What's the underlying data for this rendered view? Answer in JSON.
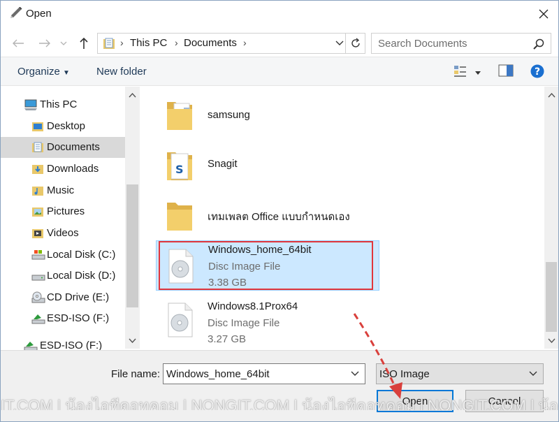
{
  "window": {
    "title": "Open",
    "title_icon": "pen-icon",
    "close_icon": "close-icon"
  },
  "navigation": {
    "back_icon": "back-arrow-icon",
    "forward_icon": "forward-arrow-icon",
    "recent_icon": "chevron-down-icon",
    "up_icon": "up-arrow-icon",
    "breadcrumb": [
      "This PC",
      "Documents"
    ],
    "search_placeholder": "Search Documents"
  },
  "toolbar": {
    "organize_label": "Organize",
    "new_folder_label": "New folder"
  },
  "sidebar": {
    "items": [
      {
        "label": "This PC",
        "icon": "computer-icon"
      },
      {
        "label": "Desktop",
        "icon": "desktop-folder-icon"
      },
      {
        "label": "Documents",
        "icon": "documents-folder-icon",
        "selected": true
      },
      {
        "label": "Downloads",
        "icon": "downloads-folder-icon"
      },
      {
        "label": "Music",
        "icon": "music-folder-icon"
      },
      {
        "label": "Pictures",
        "icon": "pictures-folder-icon"
      },
      {
        "label": "Videos",
        "icon": "videos-folder-icon"
      },
      {
        "label": "Local Disk (C:)",
        "icon": "local-disk-icon"
      },
      {
        "label": "Local Disk (D:)",
        "icon": "local-disk-icon"
      },
      {
        "label": "CD Drive (E:)",
        "icon": "cd-drive-icon"
      },
      {
        "label": "ESD-ISO (F:)",
        "icon": "usb-drive-icon"
      },
      {
        "label": "ESD-ISO (F:)",
        "icon": "usb-drive-icon"
      }
    ]
  },
  "files": [
    {
      "name": "samsung",
      "kind": "folder",
      "icon": "folder-icon"
    },
    {
      "name": "Snagit",
      "kind": "folder",
      "icon": "folder-icon"
    },
    {
      "name": "เทมเพลต Office แบบกำหนดเอง",
      "kind": "folder",
      "icon": "folder-icon"
    },
    {
      "name": "Windows_home_64bit",
      "type": "Disc Image File",
      "size": "3.38 GB",
      "icon": "disc-image-icon",
      "selected": true
    },
    {
      "name": "Windows8.1Prox64",
      "type": "Disc Image File",
      "size": "3.27 GB",
      "icon": "disc-image-icon"
    }
  ],
  "bottom": {
    "file_name_label": "File name:",
    "file_name_value": "Windows_home_64bit",
    "file_type_value": "ISO Image",
    "open_label": "Open",
    "cancel_label": "Cancel"
  },
  "watermark": "IT.COM | น้องไอทีดอทคอม | NONGIT.COM | น้องไอทีดอทคอม | NONGIT.COM | น้องไอทีดอ",
  "colors": {
    "accent": "#0078d7",
    "selection": "#cce8ff",
    "highlight_border": "#e2363b",
    "annotation_arrow": "#d9403c"
  }
}
